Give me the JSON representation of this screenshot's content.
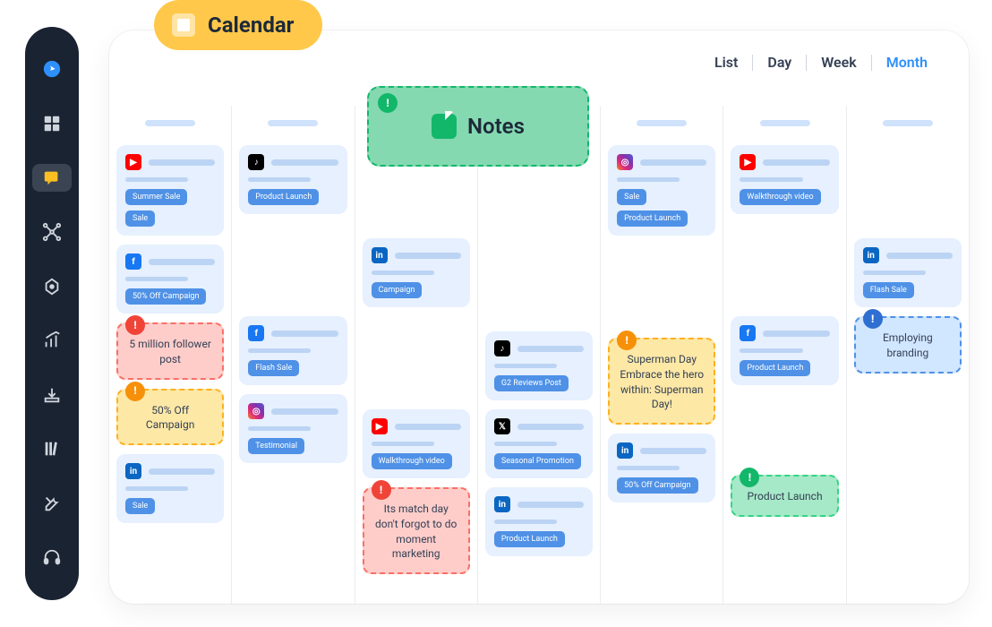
{
  "sidebar": {
    "items": [
      "navigation",
      "dashboard",
      "chat",
      "hub",
      "target",
      "analytics",
      "download",
      "library",
      "tools",
      "support"
    ]
  },
  "header": {
    "title": "Calendar"
  },
  "views": {
    "list": "List",
    "day": "Day",
    "week": "Week",
    "month": "Month",
    "active": "month"
  },
  "big_note": {
    "label": "Notes"
  },
  "notes": {
    "five_million": "5 million follower post",
    "fifty_off": "50% Off Campaign",
    "superman": "Superman Day Embrace the hero within: Superman Day!",
    "match_day": "Its match day don't forgot to do moment marketing",
    "product_launch": "Product Launch",
    "employing": "Employing branding"
  },
  "cards": {
    "c0r1": {
      "platform": "youtube",
      "tags": [
        "Summer Sale",
        "Sale"
      ]
    },
    "c0r2": {
      "platform": "facebook",
      "tags": [
        "50% Off Campaign"
      ]
    },
    "c0r5": {
      "platform": "linkedin",
      "tags": [
        "Sale"
      ]
    },
    "c1r1": {
      "platform": "tiktok",
      "tags": [
        "Product Launch"
      ]
    },
    "c1r3": {
      "platform": "facebook",
      "tags": [
        "Flash Sale"
      ]
    },
    "c1r4": {
      "platform": "instagram",
      "tags": [
        "Testimonial"
      ]
    },
    "c2r2": {
      "platform": "linkedin",
      "tags": [
        "Campaign"
      ]
    },
    "c2r4": {
      "platform": "youtube",
      "tags": [
        "Walkthrough video"
      ]
    },
    "c3r3": {
      "platform": "tiktok",
      "tags": [
        "G2 Reviews Post"
      ]
    },
    "c3r4": {
      "platform": "x",
      "tags": [
        "Seasonal Promotion"
      ]
    },
    "c3r5": {
      "platform": "linkedin",
      "tags": [
        "Product Launch"
      ]
    },
    "c4r1": {
      "platform": "instagram",
      "tags": [
        "Sale",
        "Product Launch"
      ]
    },
    "c4r4": {
      "platform": "linkedin",
      "tags": [
        "50% Off Campaign"
      ]
    },
    "c5r1": {
      "platform": "youtube",
      "tags": [
        "Walkthrough video"
      ]
    },
    "c5r3": {
      "platform": "facebook",
      "tags": [
        "Product Launch"
      ]
    },
    "c6r2": {
      "platform": "linkedin",
      "tags": [
        "Flash Sale"
      ]
    }
  }
}
